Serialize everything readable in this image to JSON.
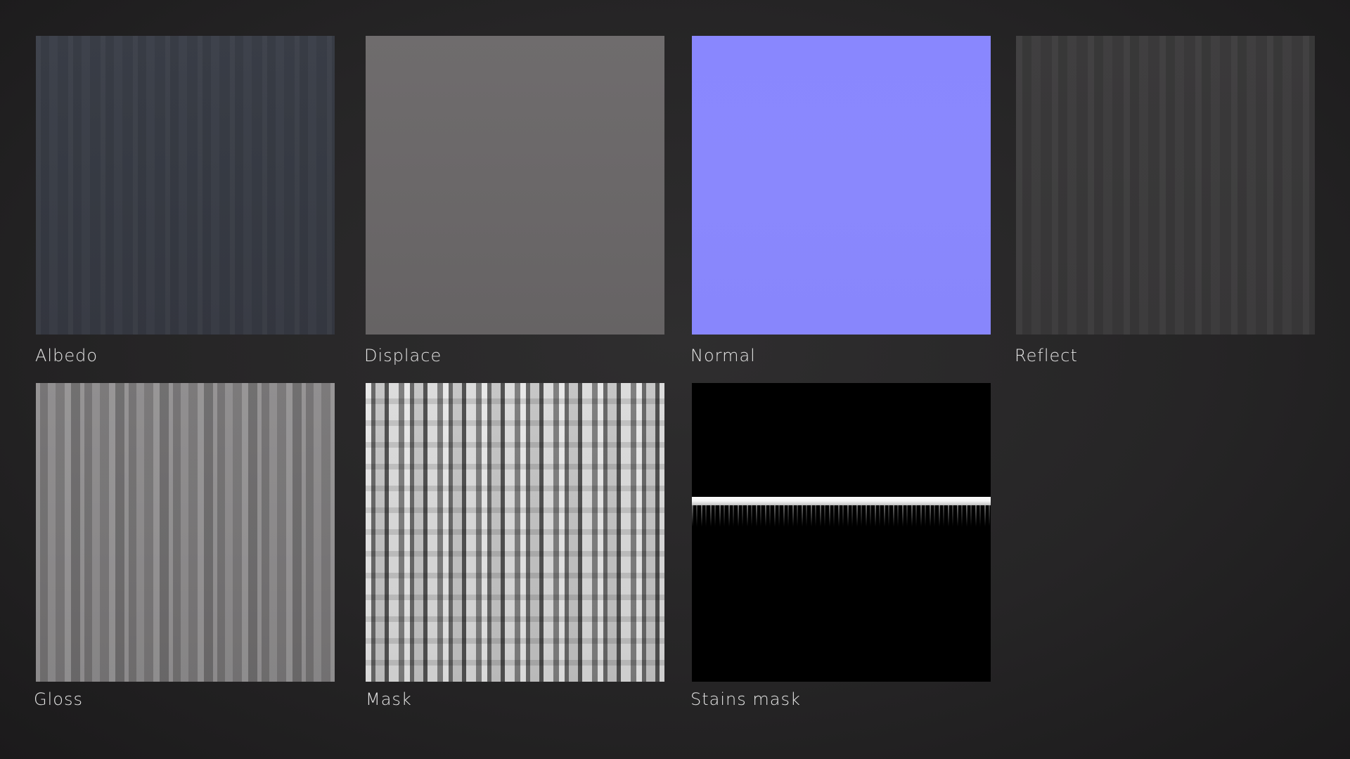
{
  "maps": [
    {
      "label": "Albedo",
      "texture": "albedo-texture"
    },
    {
      "label": "Displace",
      "texture": "displace-texture"
    },
    {
      "label": "Normal",
      "texture": "normal-texture"
    },
    {
      "label": "Reflect",
      "texture": "reflect-texture"
    },
    {
      "label": "Gloss",
      "texture": "gloss-texture"
    },
    {
      "label": "Mask",
      "texture": "mask-texture"
    },
    {
      "label": "Stains mask",
      "texture": "stains-mask-texture"
    }
  ],
  "colors": {
    "background": "#262526",
    "label": "#e6e6e6",
    "albedo": "#393d46",
    "displace": "#6c696a",
    "normal": "#8987fd",
    "reflect": "#3a393a",
    "stains_mask": "#000000"
  }
}
